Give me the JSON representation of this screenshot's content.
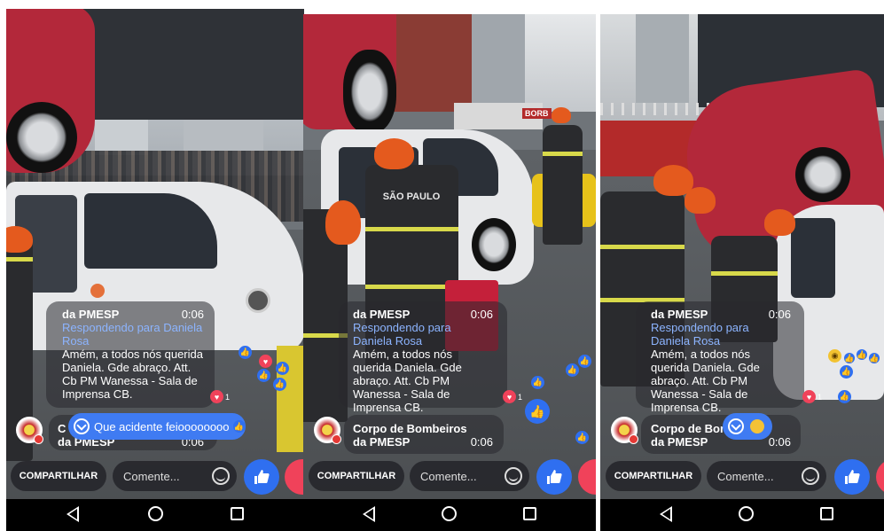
{
  "panels": [
    {
      "comment_main": {
        "name": "da PMESP",
        "time": "0:06",
        "reply": "Respondendo para Daniela Rosa",
        "text": "Amém, a todos nós querida Daniela. Gde abraço. Att. Cb PM Wanessa - Sala de Imprensa CB."
      },
      "comment_second": {
        "name_partial": "C",
        "name2": "da PMESP",
        "time": "0:06"
      },
      "new_comment_pill": "Que acidente feioooooooo",
      "reaction_count": "1",
      "share_label": "COMPARTILHAR",
      "comment_placeholder": "Comente..."
    },
    {
      "comment_main": {
        "name": "da PMESP",
        "time": "0:06",
        "reply": "Respondendo para Daniela Rosa",
        "text": "Amém, a todos nós querida Daniela. Gde abraço. Att. Cb PM Wanessa - Sala de Imprensa CB."
      },
      "comment_second": {
        "name": "Corpo de Bombeiros",
        "name2": "da PMESP",
        "time": "0:06"
      },
      "reaction_count": "1",
      "share_label": "COMPARTILHAR",
      "comment_placeholder": "Comente..."
    },
    {
      "comment_main": {
        "name": "da PMESP",
        "time": "0:06",
        "reply": "Respondendo para Daniela Rosa",
        "text": "Amém, a todos nós querida Daniela. Gde abraço. Att. Cb PM Wanessa - Sala de Imprensa CB."
      },
      "comment_second": {
        "name": "Corpo de Bom",
        "name2": "da PMESP",
        "time": "0:06"
      },
      "reaction_count": "1",
      "share_label": "COMPARTILHAR",
      "comment_placeholder": "Comente..."
    }
  ],
  "photo_text": {
    "jacket_label": "SÃO PAULO",
    "sign_text": "BORB"
  },
  "icons": {
    "like": "thumbs-up-icon",
    "love": "heart-icon",
    "wow": "wow-face-icon",
    "emoji": "emoji-icon",
    "back": "back-triangle-icon",
    "home": "home-circle-icon",
    "recent": "recent-apps-square-icon",
    "new_comments": "chevron-down-icon"
  },
  "colors": {
    "like_blue": "#2f6ff0",
    "love_red": "#f0425a",
    "reply_link": "#8cb4ff",
    "pill_blue": "#3f7bf2"
  }
}
